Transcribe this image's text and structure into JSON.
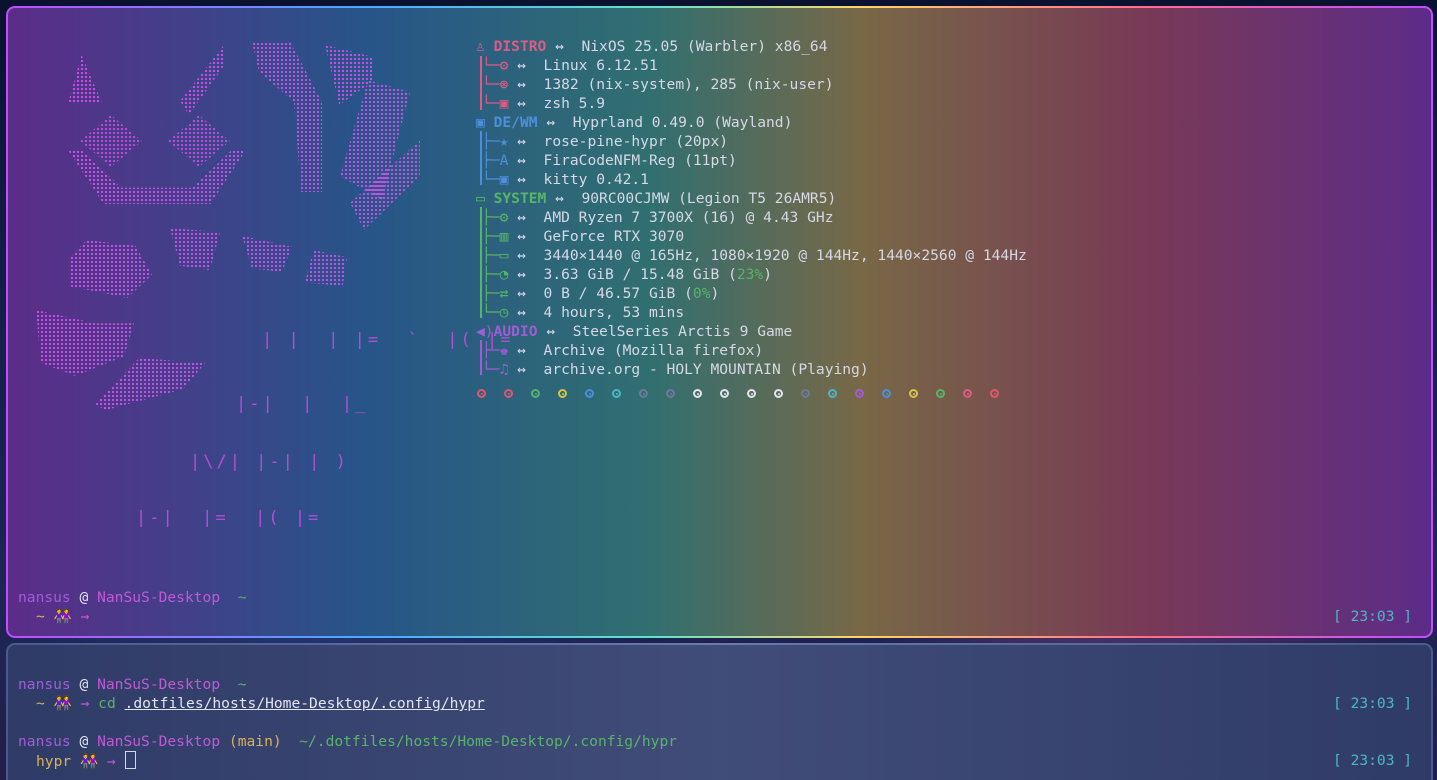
{
  "art": {
    "lines": [
      "ꞁꞁꞁꞁꞁ ˋˋ ꞁꞁ ꞁꞁ",
      "ꞁꞁ ꞁꞁ",
      "ꞁꞁ ꞁꞁ ꞁꞁ",
      "ꞁꞁ ꞁꞁ ꞁꞁ"
    ]
  },
  "fetch": {
    "distro": {
      "label": "DISTRO",
      "value": "NixOS 25.05 (Warbler) x86_64",
      "items": [
        "Linux 6.12.51",
        "1382 (nix-system), 285 (nix-user)",
        "zsh 5.9"
      ]
    },
    "dewm": {
      "label": "DE/WM",
      "value": "Hyprland 0.49.0 (Wayland)",
      "items": [
        "rose-pine-hypr (20px)",
        "FiraCodeNFM-Reg (11pt)",
        "kitty 0.42.1"
      ]
    },
    "system": {
      "label": "SYSTEM",
      "value": "90RC00CJMW (Legion T5 26AMR5)",
      "items": [
        "AMD Ryzen 7 3700X (16) @ 4.43 GHz",
        "GeForce RTX 3070",
        "3440×1440 @ 165Hz, 1080×1920 @ 144Hz, 1440×2560 @ 144Hz",
        "3.63 GiB / 15.48 GiB (",
        "23%",
        ")",
        "0 B / 46.57 GiB (",
        "0%",
        ")",
        "4 hours, 53 mins"
      ]
    },
    "audio": {
      "label": "AUDIO",
      "value": "SteelSeries Arctis 9 Game",
      "items": [
        "Archive (Mozilla firefox)",
        "archive.org - HOLY MOUNTAIN (Playing)"
      ]
    },
    "arrow": "↔",
    "palette": [
      "#e0566e",
      "#e0566e",
      "#58b46a",
      "#d8c24a",
      "#4d8fdc",
      "#4cb6c6",
      "#6a7a98",
      "#6a7a98",
      "#e2e4ee",
      "#e2e4ee",
      "#e2e4ee",
      "#e2e4ee",
      "#6a7a98",
      "#4cb6c6",
      "#a05cd6",
      "#4d8fdc",
      "#d8c24a",
      "#58b46a",
      "#e05a86",
      "#e0566e"
    ]
  },
  "prompt_top": {
    "user": "nansus",
    "at": "@",
    "host": "NanSuS-Desktop",
    "dir": "~",
    "line2_dir": "~",
    "people": "👭",
    "arrow": "→",
    "time": "[ 23:03 ]"
  },
  "prompt_bot1": {
    "user": "nansus",
    "at": "@",
    "host": "NanSuS-Desktop",
    "dir": "~",
    "line2_dir": "~",
    "people": "👭",
    "arrow": "→",
    "cmd": "cd",
    "cmd_arg": ".dotfiles/hosts/Home-Desktop/.config/hypr",
    "time": "[ 23:03 ]"
  },
  "prompt_bot2": {
    "user": "nansus",
    "at": "@",
    "host": "NanSuS-Desktop",
    "branch": "(main)",
    "dir": "~/.dotfiles/hosts/Home-Desktop/.config/hypr",
    "line2_dir": "hypr",
    "people": "👭",
    "arrow": "→",
    "time": "[ 23:03 ]"
  },
  "colors": {
    "magenta": "#c158d6",
    "pink": "#e05a86",
    "blue": "#4d8fdc",
    "green": "#58b46a",
    "purple": "#a05cd6",
    "cyan": "#4cb6c6"
  }
}
